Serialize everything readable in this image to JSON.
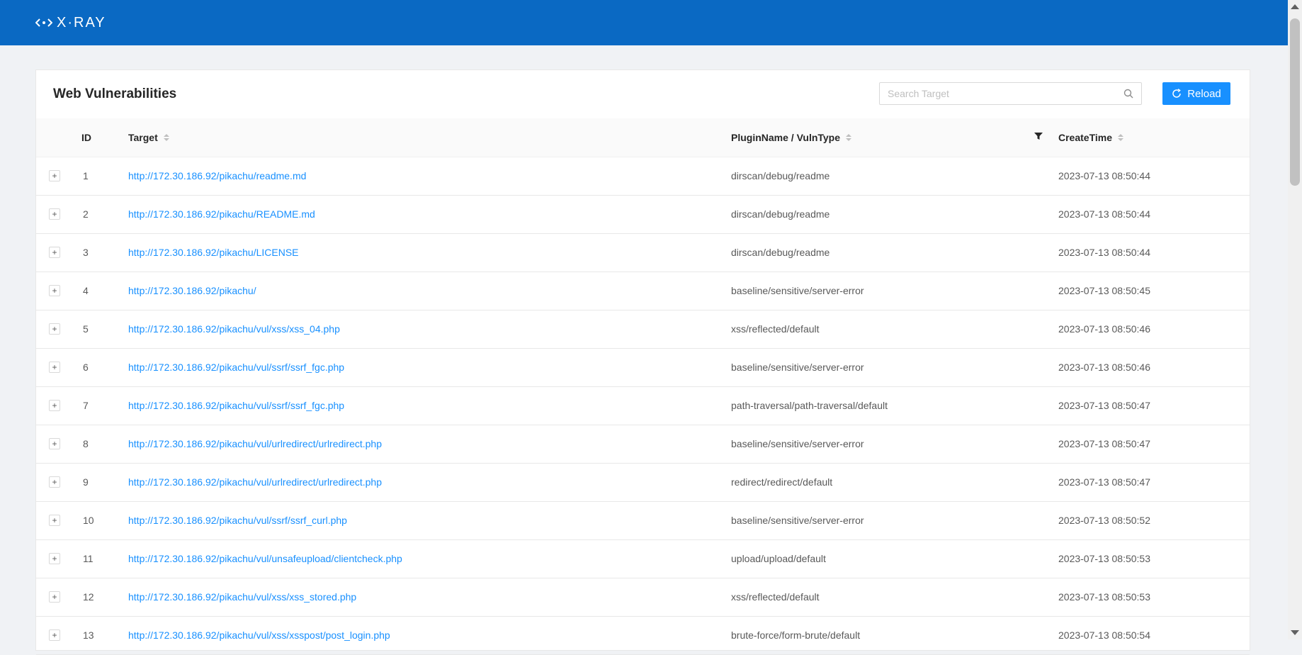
{
  "app": {
    "logo_text": "X·RAY",
    "brand_color": "#0a69c3",
    "accent_color": "#1890ff"
  },
  "card": {
    "title": "Web Vulnerabilities",
    "search_placeholder": "Search Target",
    "reload_label": "Reload"
  },
  "table": {
    "columns": {
      "id": "ID",
      "target": "Target",
      "plugin": "PluginName / VulnType",
      "time": "CreateTime"
    },
    "rows": [
      {
        "id": "1",
        "target": "http://172.30.186.92/pikachu/readme.md",
        "plugin": "dirscan/debug/readme",
        "time": "2023-07-13 08:50:44"
      },
      {
        "id": "2",
        "target": "http://172.30.186.92/pikachu/README.md",
        "plugin": "dirscan/debug/readme",
        "time": "2023-07-13 08:50:44"
      },
      {
        "id": "3",
        "target": "http://172.30.186.92/pikachu/LICENSE",
        "plugin": "dirscan/debug/readme",
        "time": "2023-07-13 08:50:44"
      },
      {
        "id": "4",
        "target": "http://172.30.186.92/pikachu/",
        "plugin": "baseline/sensitive/server-error",
        "time": "2023-07-13 08:50:45"
      },
      {
        "id": "5",
        "target": "http://172.30.186.92/pikachu/vul/xss/xss_04.php",
        "plugin": "xss/reflected/default",
        "time": "2023-07-13 08:50:46"
      },
      {
        "id": "6",
        "target": "http://172.30.186.92/pikachu/vul/ssrf/ssrf_fgc.php",
        "plugin": "baseline/sensitive/server-error",
        "time": "2023-07-13 08:50:46"
      },
      {
        "id": "7",
        "target": "http://172.30.186.92/pikachu/vul/ssrf/ssrf_fgc.php",
        "plugin": "path-traversal/path-traversal/default",
        "time": "2023-07-13 08:50:47"
      },
      {
        "id": "8",
        "target": "http://172.30.186.92/pikachu/vul/urlredirect/urlredirect.php",
        "plugin": "baseline/sensitive/server-error",
        "time": "2023-07-13 08:50:47"
      },
      {
        "id": "9",
        "target": "http://172.30.186.92/pikachu/vul/urlredirect/urlredirect.php",
        "plugin": "redirect/redirect/default",
        "time": "2023-07-13 08:50:47"
      },
      {
        "id": "10",
        "target": "http://172.30.186.92/pikachu/vul/ssrf/ssrf_curl.php",
        "plugin": "baseline/sensitive/server-error",
        "time": "2023-07-13 08:50:52"
      },
      {
        "id": "11",
        "target": "http://172.30.186.92/pikachu/vul/unsafeupload/clientcheck.php",
        "plugin": "upload/upload/default",
        "time": "2023-07-13 08:50:53"
      },
      {
        "id": "12",
        "target": "http://172.30.186.92/pikachu/vul/xss/xss_stored.php",
        "plugin": "xss/reflected/default",
        "time": "2023-07-13 08:50:53"
      },
      {
        "id": "13",
        "target": "http://172.30.186.92/pikachu/vul/xss/xsspost/post_login.php",
        "plugin": "brute-force/form-brute/default",
        "time": "2023-07-13 08:50:54"
      }
    ]
  }
}
